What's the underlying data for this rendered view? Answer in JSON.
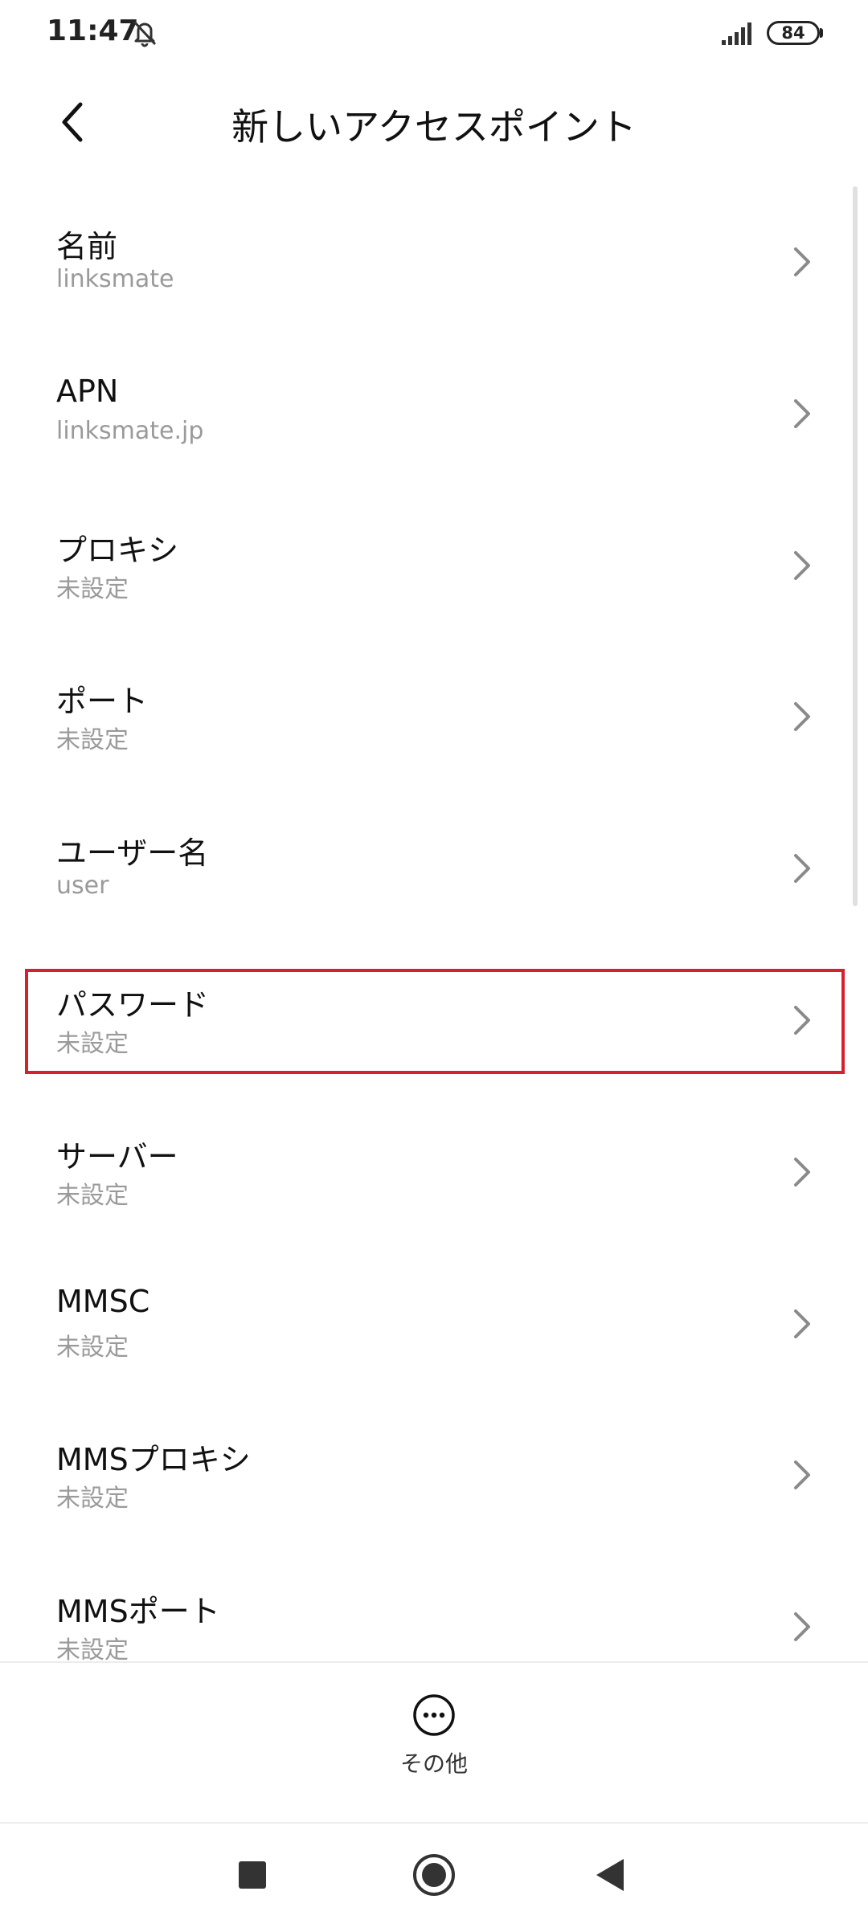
{
  "status_bar": {
    "time": "11:47",
    "battery": "84",
    "icons": [
      "bell-off-icon",
      "signal-icon",
      "battery-icon"
    ]
  },
  "header": {
    "title": "新しいアクセスポイント",
    "back_icon": "chevron-left-icon"
  },
  "settings": [
    {
      "title": "名前",
      "value": "linksmate"
    },
    {
      "title": "APN",
      "value": "linksmate.jp"
    },
    {
      "title": "プロキシ",
      "value": "未設定"
    },
    {
      "title": "ポート",
      "value": "未設定"
    },
    {
      "title": "ユーザー名",
      "value": "user"
    },
    {
      "title": "パスワード",
      "value": "未設定"
    },
    {
      "title": "サーバー",
      "value": "未設定"
    },
    {
      "title": "MMSC",
      "value": "未設定"
    },
    {
      "title": "MMSプロキシ",
      "value": "未設定"
    },
    {
      "title": "MMSポート",
      "value": "未設定"
    }
  ],
  "highlight_color": "#d8202c",
  "action_bar": {
    "more_label": "その他",
    "more_icon": "more-horizontal-icon"
  },
  "nav_bar": {
    "icons": [
      "recent-apps-icon",
      "home-icon",
      "back-triangle-icon"
    ]
  }
}
